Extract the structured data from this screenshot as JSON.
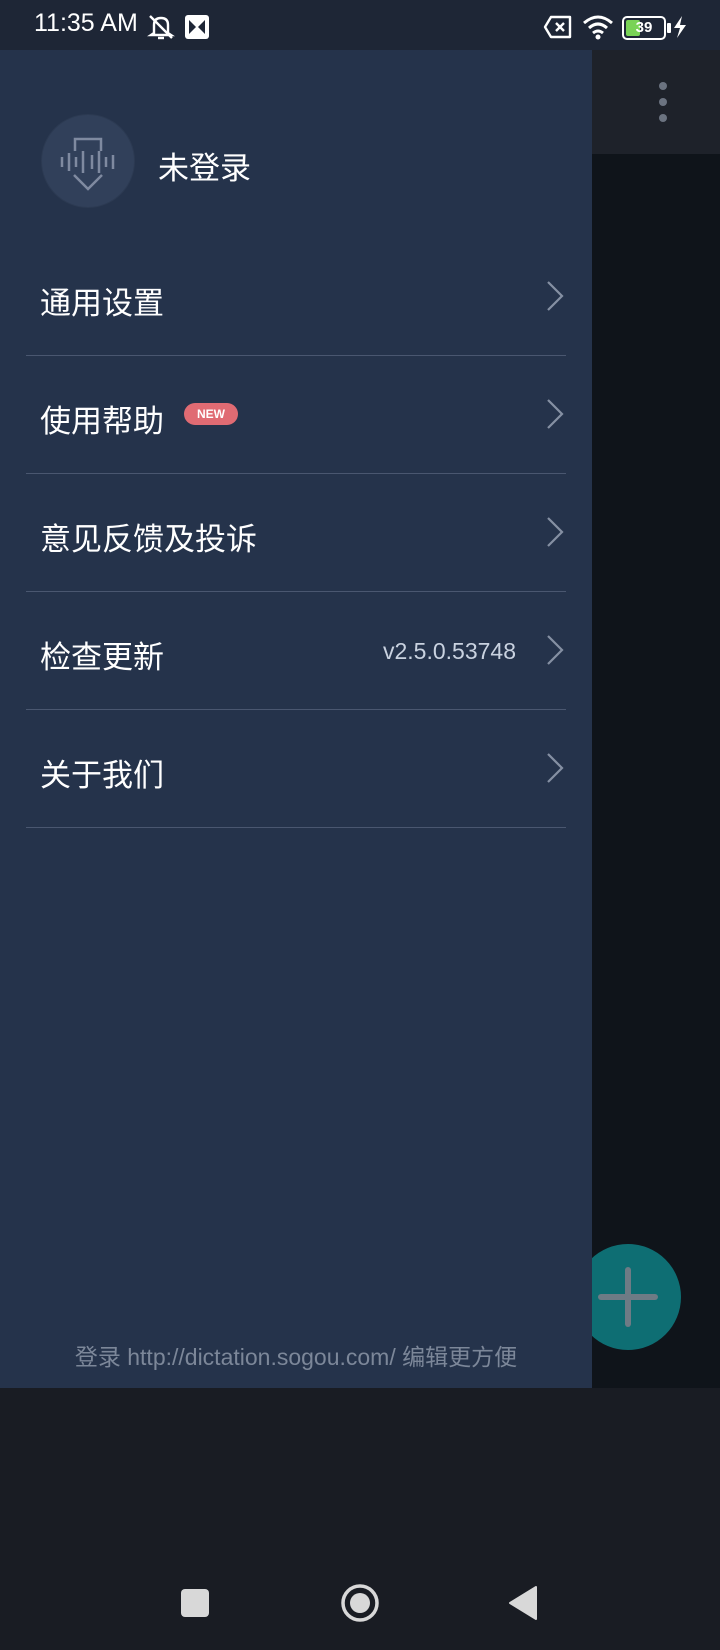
{
  "status_bar": {
    "time": "11:35 AM",
    "battery_level": "39"
  },
  "drawer": {
    "login_status": "未登录",
    "menu": [
      {
        "label": "通用设置"
      },
      {
        "label": "使用帮助",
        "badge": "NEW"
      },
      {
        "label": "意见反馈及投诉"
      },
      {
        "label": "检查更新",
        "value": "v2.5.0.53748"
      },
      {
        "label": "关于我们"
      }
    ],
    "footer": "登录 http://dictation.sogou.com/ 编辑更方便"
  },
  "colors": {
    "drawer_bg": "#25334b",
    "status_bar_bg": "#1e2636",
    "badge": "#e06b73",
    "fab": "#0e6e73"
  },
  "icons": {
    "avatar": "voice-mic-download-icon",
    "chevron": "chevron-right-icon",
    "fab": "plus-icon",
    "more": "more-vertical-icon",
    "nav": [
      "square-recents-icon",
      "circle-home-icon",
      "triangle-back-icon"
    ]
  }
}
